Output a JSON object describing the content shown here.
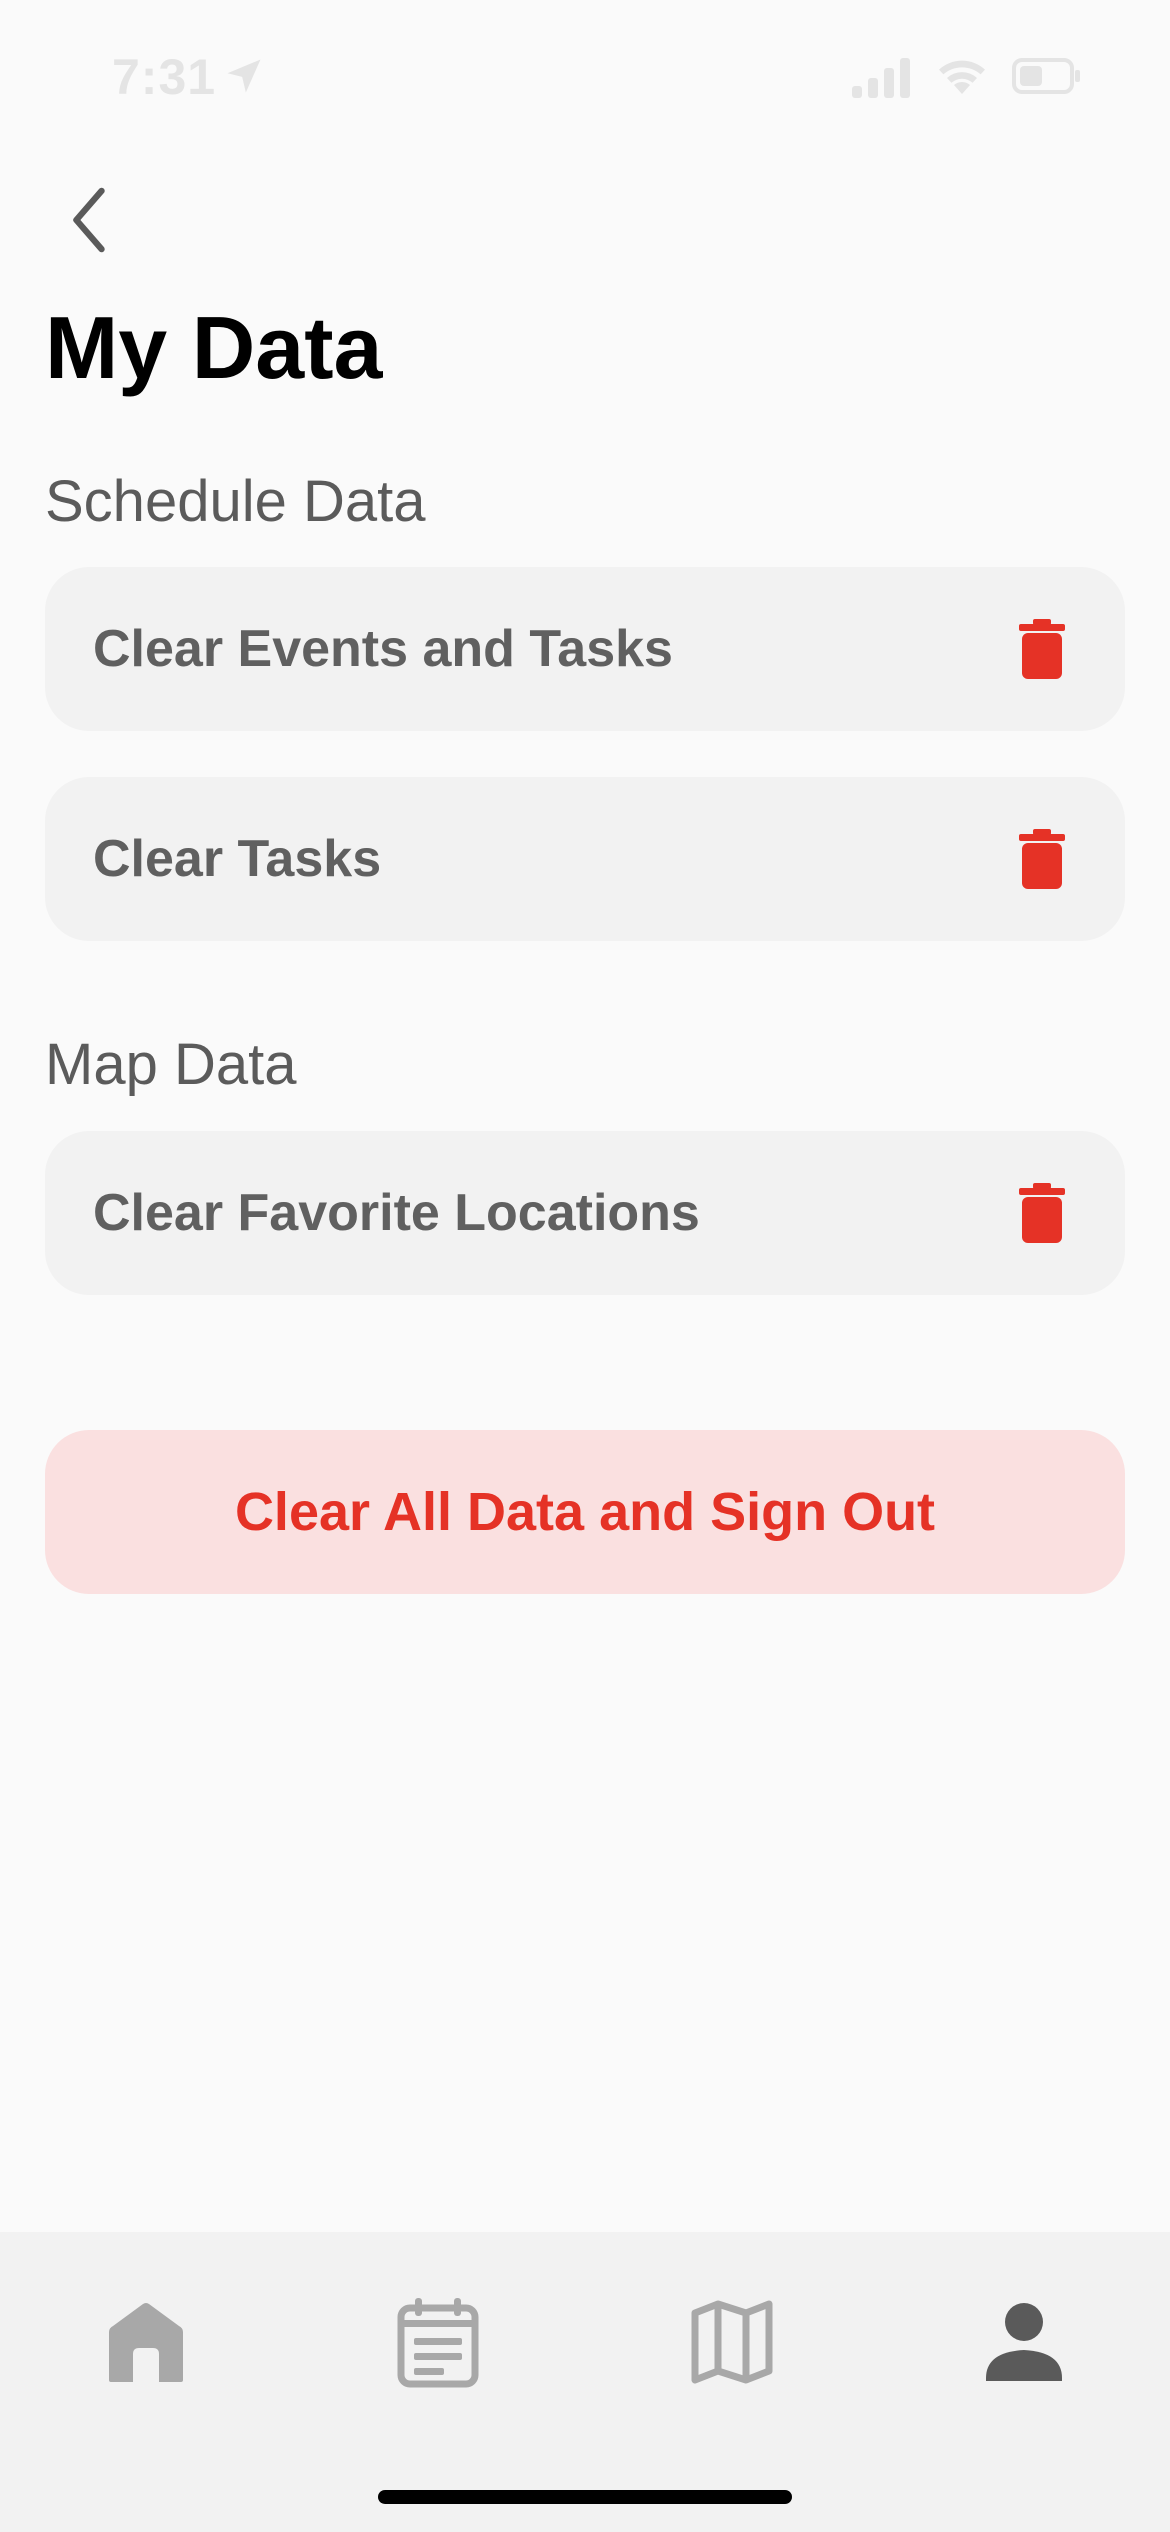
{
  "status_bar": {
    "time": "7:31",
    "icons": [
      "location-arrow-icon",
      "signal-icon",
      "wifi-icon",
      "battery-icon"
    ]
  },
  "header": {
    "back_icon": "chevron-left-icon",
    "title": "My Data"
  },
  "sections": [
    {
      "title": "Schedule Data",
      "items": [
        {
          "label": "Clear Events and Tasks",
          "icon": "trash-icon"
        },
        {
          "label": "Clear Tasks",
          "icon": "trash-icon"
        }
      ]
    },
    {
      "title": "Map Data",
      "items": [
        {
          "label": "Clear Favorite Locations",
          "icon": "trash-icon"
        }
      ]
    }
  ],
  "danger_action": {
    "label": "Clear All Data and Sign Out"
  },
  "tab_bar": {
    "tabs": [
      {
        "icon": "home-icon",
        "active": false
      },
      {
        "icon": "calendar-icon",
        "active": false
      },
      {
        "icon": "map-icon",
        "active": false
      },
      {
        "icon": "person-icon",
        "active": true
      }
    ]
  },
  "colors": {
    "background": "#fafafa",
    "row_background": "#f2f2f2",
    "row_text": "#606060",
    "danger": "#e53226",
    "danger_background": "#fae0e0",
    "tab_inactive": "#a8a8a8",
    "tab_active": "#5a5a5a"
  }
}
